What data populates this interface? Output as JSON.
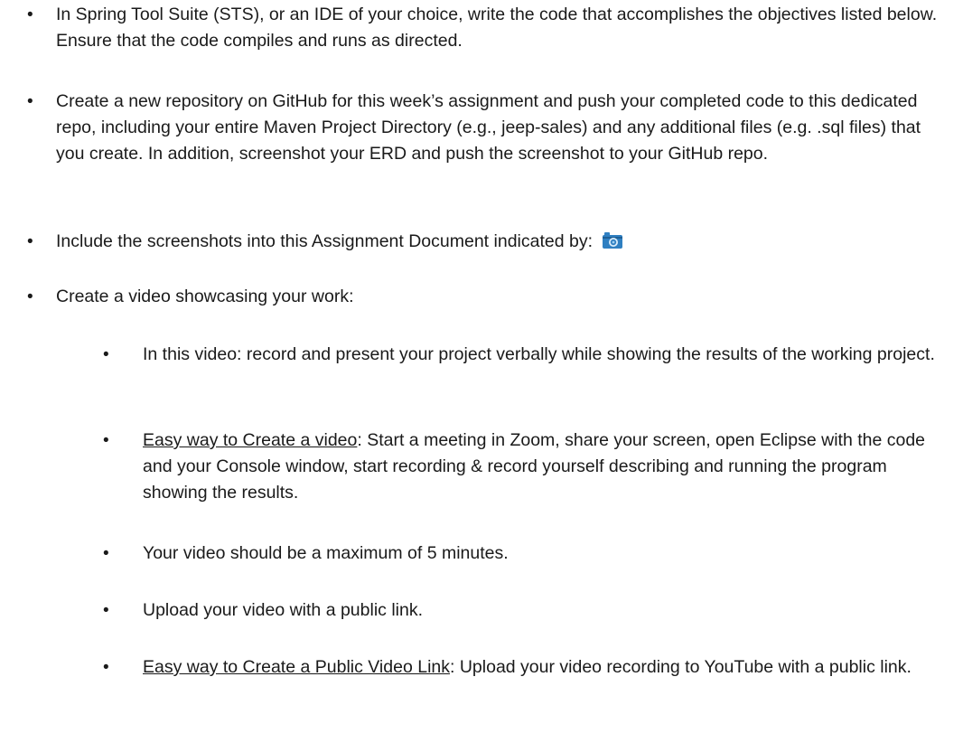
{
  "bullet_char": "•",
  "items": {
    "item1": "In Spring Tool Suite (STS), or an IDE of your choice, write the code that accomplishes the objectives listed below. Ensure that the code compiles and runs as directed.",
    "item2": "Create a new repository on GitHub for this week’s assignment and push your completed code to this dedicated repo, including your entire Maven Project Directory (e.g., jeep-sales) and any additional files (e.g. .sql files) that you create.  In addition, screenshot your ERD and push the screenshot to your GitHub repo.",
    "item3": "Include the screenshots into this Assignment Document indicated by:",
    "item4": "Create a video showcasing your work:",
    "sub1": "In this video: record and present your project verbally while showing the results of the working project.",
    "sub2_link": "Easy way to Create a video",
    "sub2_rest": ":  Start a meeting in Zoom, share your screen, open Eclipse with the code and your Console window, start recording & record yourself describing and running the program showing the results.",
    "sub3": "Your video should be a maximum of 5 minutes.",
    "sub4": "Upload your video with a public link.",
    "sub5_link": "Easy way to Create a Public Video Link",
    "sub5_rest": ":  Upload your video recording to YouTube with a public link."
  },
  "icons": {
    "camera": "camera-icon",
    "camera_color": "#2f7fc1"
  }
}
